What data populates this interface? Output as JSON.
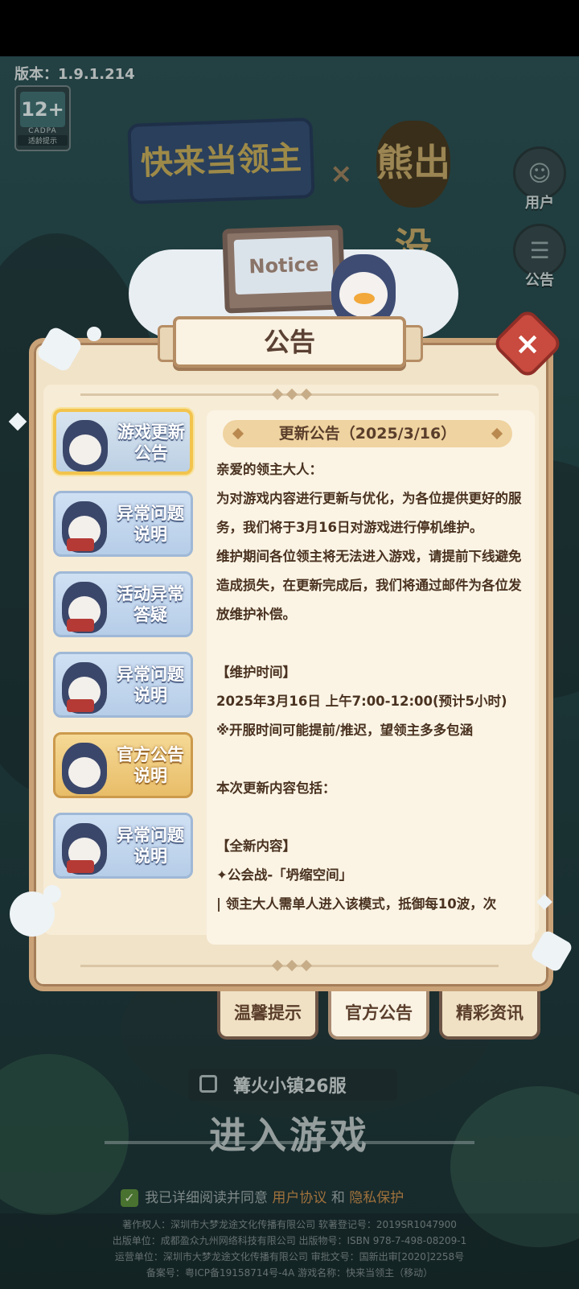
{
  "version": "版本：1.9.1.214",
  "age_badge": {
    "age": "12+",
    "org": "CADPA",
    "tip": "适龄提示"
  },
  "logo": {
    "game_title": "快来当领主",
    "collab_symbol": "×",
    "collab_title": "熊出没"
  },
  "side_buttons": {
    "user": "用户",
    "notice": "公告"
  },
  "modal": {
    "title": "公告",
    "board_text": "Notice",
    "close_icon": "×",
    "tabs": [
      {
        "label": "游戏更新\n公告",
        "style": "active"
      },
      {
        "label": "异常问题\n说明",
        "style": "blue"
      },
      {
        "label": "活动异常\n答疑",
        "style": "blue"
      },
      {
        "label": "异常问题\n说明",
        "style": "blue"
      },
      {
        "label": "官方公告\n说明",
        "style": "gold"
      },
      {
        "label": "异常问题\n说明",
        "style": "blue"
      }
    ],
    "content": {
      "heading": "更新公告（2025/3/16）",
      "lines": [
        "亲爱的领主大人：",
        "为对游戏内容进行更新与优化，为各位提供更好的服务，我们将于3月16日对游戏进行停机维护。",
        "维护期间各位领主将无法进入游戏，请提前下线避免造成损失，在更新完成后，我们将通过邮件为各位发放维护补偿。",
        "",
        "【维护时间】",
        "2025年3月16日 上午7:00-12:00(预计5小时)",
        "※开服时间可能提前/推迟，望领主多多包涵",
        "",
        "本次更新内容包括：",
        "",
        "【全新内容】",
        "✦公会战-「坍缩空间」",
        "| 领主大人需单人进入该模式，抵御每10波，次"
      ]
    },
    "bottom_tabs": [
      {
        "label": "温馨提示",
        "active": false
      },
      {
        "label": "官方公告",
        "active": true
      },
      {
        "label": "精彩资讯",
        "active": false
      }
    ]
  },
  "server": {
    "name": "篝火小镇26服"
  },
  "enter_button": "进入游戏",
  "agreement": {
    "prefix": "我已详细阅读并同意",
    "link1": "用户协议",
    "and": "和",
    "link2": "隐私保护"
  },
  "footer": [
    "著作权人：深圳市大梦龙途文化传播有限公司  软著登记号：2019SR1047900",
    "出版单位：成都盈众九州网络科技有限公司  出版物号：ISBN 978-7-498-08209-1",
    "运营单位：深圳市大梦龙途文化传播有限公司  审批文号：国新出审[2020]2258号",
    "备案号：粤ICP备19158714号-4A  游戏名称：快来当领主（移动）"
  ]
}
